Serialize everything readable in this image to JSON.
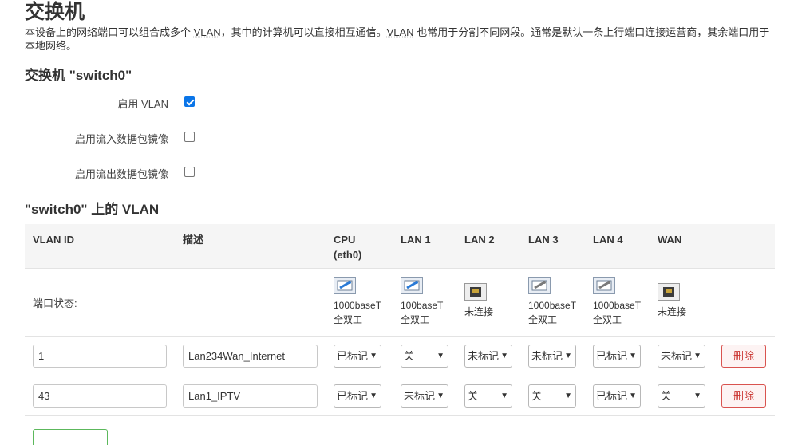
{
  "page": {
    "title": "交换机",
    "description_parts": [
      "本设备上的网络端口可以组合成多个 ",
      "VLAN",
      "，其中的计算机可以直接相互通信。",
      "VLAN",
      " 也常用于分割不同网段。通常是默认一条上行端口连接运营商，其余端口用于本地网络。"
    ]
  },
  "switch_section": {
    "title": "交换机 \"switch0\"",
    "options": [
      {
        "label": "启用 VLAN",
        "checked": true
      },
      {
        "label": "启用流入数据包镜像",
        "checked": false
      },
      {
        "label": "启用流出数据包镜像",
        "checked": false
      }
    ]
  },
  "vlan_section": {
    "title": "\"switch0\" 上的 VLAN",
    "headers": {
      "vlan_id": "VLAN ID",
      "desc": "描述",
      "cpu_line1": "CPU",
      "cpu_line2": "(eth0)",
      "lan1": "LAN 1",
      "lan2": "LAN 2",
      "lan3": "LAN 3",
      "lan4": "LAN 4",
      "wan": "WAN"
    },
    "status_label": "端口状态:",
    "ports": [
      {
        "line1": "1000baseT",
        "line2": "全双工",
        "connected": true
      },
      {
        "line1": "100baseT",
        "line2": "全双工",
        "connected": true
      },
      {
        "line1": "未连接",
        "line2": "",
        "connected": false
      },
      {
        "line1": "1000baseT",
        "line2": "全双工",
        "connected": true
      },
      {
        "line1": "1000baseT",
        "line2": "全双工",
        "connected": true
      },
      {
        "line1": "未连接",
        "line2": "",
        "connected": false
      }
    ],
    "rows": [
      {
        "vlan_id": "1",
        "desc": "Lan234Wan_Internet",
        "ports": [
          "已标记",
          "关",
          "未标记",
          "未标记",
          "已标记",
          "未标记"
        ],
        "delete_label": "删除"
      },
      {
        "vlan_id": "43",
        "desc": "Lan1_IPTV",
        "ports": [
          "已标记",
          "未标记",
          "关",
          "关",
          "已标记",
          "关"
        ],
        "delete_label": "删除"
      }
    ]
  }
}
